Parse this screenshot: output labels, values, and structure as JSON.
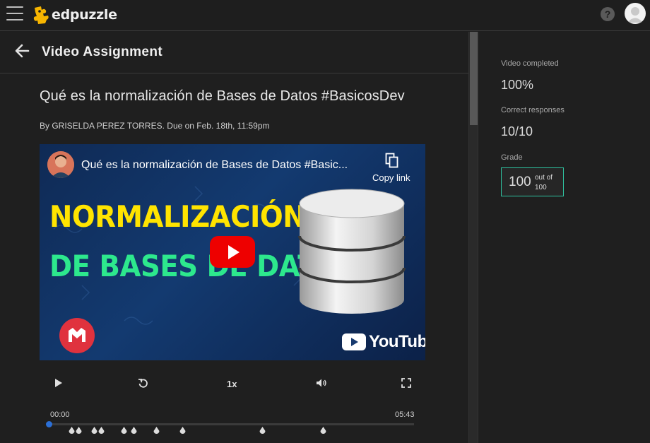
{
  "app": {
    "brand": "edpuzzle"
  },
  "header": {
    "menu_icon": "hamburger-menu-icon",
    "help_icon": "question-circle-icon",
    "avatar_icon": "user-avatar-icon"
  },
  "assignment": {
    "page_title": "Video Assignment",
    "video_title": "Qué es la normalización de Bases de Datos #BasicosDev",
    "byline": "By GRISELDA PEREZ TORRES. Due on Feb. 18th, 11:59pm"
  },
  "video": {
    "embed_title": "Qué es la normalización de Bases de Datos #Basic...",
    "copy_link_label": "Copy link",
    "thumbnail_line1": "NORMALIZACIÓN",
    "thumbnail_line2": "DE BASES DE DATOS",
    "platform_label": "YouTube",
    "colors": {
      "line1": "#ffe400",
      "line2": "#2de88d",
      "play_button": "#ee0000"
    }
  },
  "player": {
    "play_icon": "play-icon",
    "replay_icon": "replay-icon",
    "speed_label": "1x",
    "volume_icon": "volume-icon",
    "fullscreen_icon": "fullscreen-icon",
    "time_current": "00:00",
    "time_total": "05:43",
    "progress_fraction": 0.0,
    "question_marker_count": 10,
    "accent": "#2b6fd6"
  },
  "results": {
    "completed_label": "Video completed",
    "completed_value": "100%",
    "correct_label": "Correct responses",
    "correct_value": "10/10",
    "grade_label": "Grade",
    "grade_value": "100",
    "grade_out_of": "out of 100",
    "grade_accent": "#2fc3a0"
  }
}
